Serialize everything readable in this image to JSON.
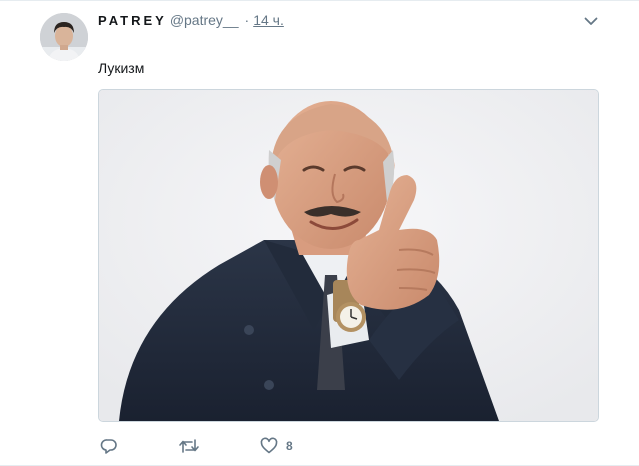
{
  "tweet": {
    "display_name": "PATREY",
    "screen_name": "@patrey__",
    "separator": "·",
    "timestamp": "14 ч.",
    "text": "Лукизм",
    "actions": {
      "reply_icon": "reply-icon",
      "retweet_icon": "retweet-icon",
      "like_icon": "heart-icon",
      "like_count": "8"
    },
    "menu_icon": "chevron-down-icon"
  },
  "colors": {
    "primary_text": "#14171a",
    "secondary_text": "#657786",
    "border": "#ccd6dd",
    "divider": "#e6ecf0"
  }
}
